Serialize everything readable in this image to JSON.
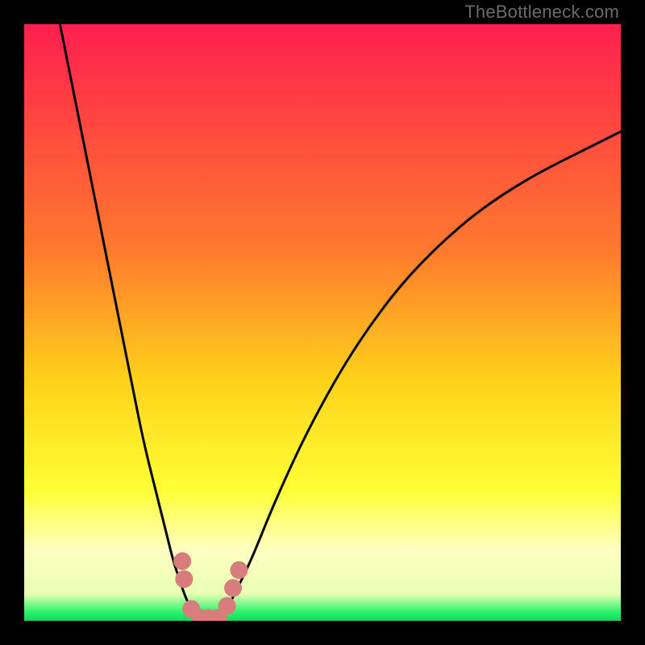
{
  "watermark": "TheBottleneck.com",
  "colors": {
    "top": "#ff1f4f",
    "mid_upper": "#ff7a2d",
    "mid": "#ffd31a",
    "mid_lower": "#ffff35",
    "pale": "#ffffc0",
    "green": "#2bf46b",
    "curve": "#000000",
    "marker": "#d97c7c"
  },
  "chart_data": {
    "type": "line",
    "title": "",
    "xlabel": "",
    "ylabel": "",
    "xlim": [
      0,
      100
    ],
    "ylim": [
      0,
      100
    ],
    "grid": false,
    "legend": false,
    "series": [
      {
        "name": "left-branch",
        "x": [
          6,
          10,
          14,
          18,
          20,
          22,
          24,
          25,
          26,
          27,
          28,
          29
        ],
        "y": [
          100,
          80,
          60,
          40,
          30,
          22,
          14,
          10,
          7,
          4,
          2,
          0
        ]
      },
      {
        "name": "right-branch",
        "x": [
          33,
          35,
          38,
          42,
          48,
          56,
          66,
          80,
          100
        ],
        "y": [
          0,
          4,
          10,
          20,
          33,
          47,
          60,
          72,
          82
        ]
      },
      {
        "name": "trough-markers",
        "x": [
          26.5,
          26.8,
          28.0,
          29.5,
          31.0,
          32.5,
          34.0,
          35.0,
          36.0
        ],
        "y": [
          10,
          7,
          2,
          0.5,
          0.5,
          0.5,
          2.5,
          5.5,
          8.5
        ]
      }
    ],
    "gradient_stops": [
      {
        "offset": 0.0,
        "color": "#ff1f4f"
      },
      {
        "offset": 0.38,
        "color": "#ff7a2d"
      },
      {
        "offset": 0.6,
        "color": "#ffd31a"
      },
      {
        "offset": 0.78,
        "color": "#ffff35"
      },
      {
        "offset": 0.88,
        "color": "#ffffc0"
      },
      {
        "offset": 0.955,
        "color": "#e7ffb3"
      },
      {
        "offset": 0.985,
        "color": "#2bf46b"
      },
      {
        "offset": 1.0,
        "color": "#17d65d"
      }
    ]
  }
}
